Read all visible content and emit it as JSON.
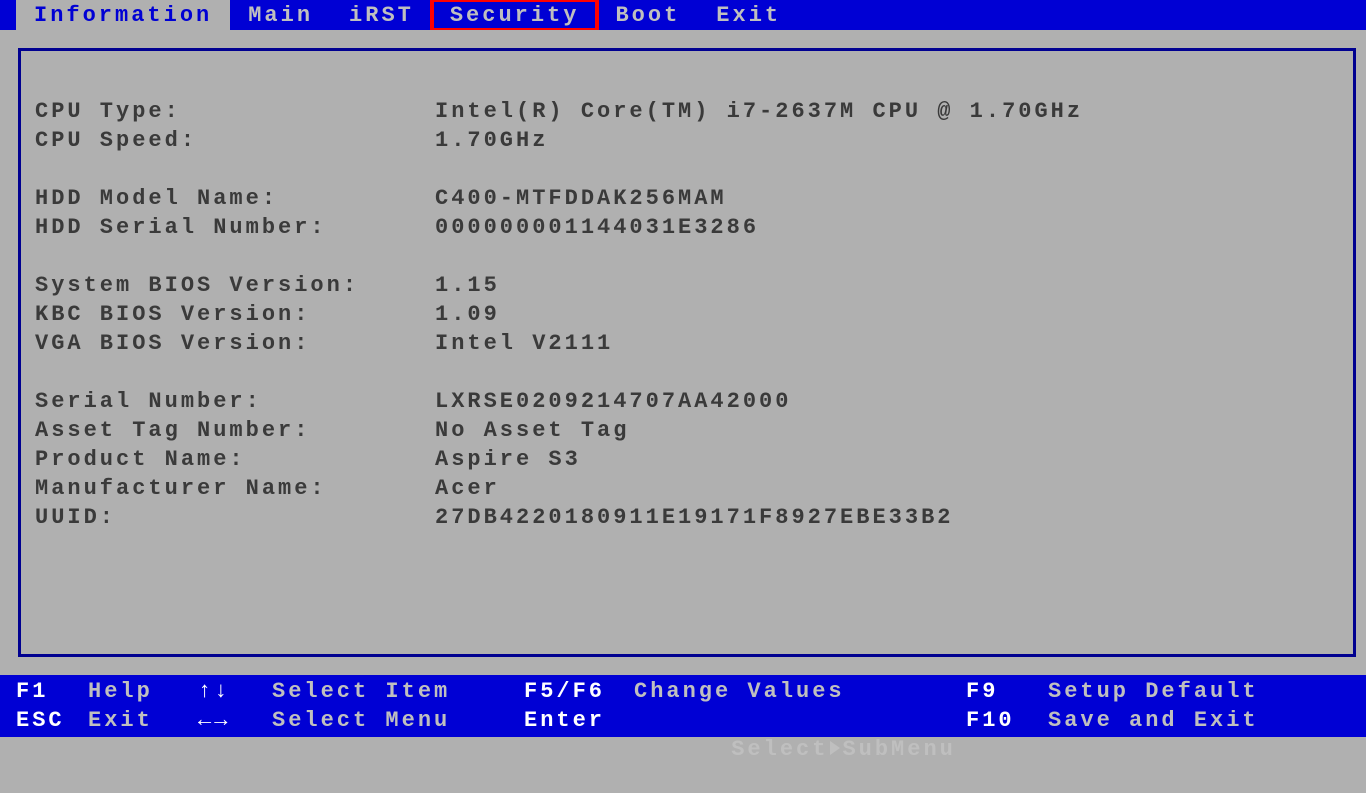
{
  "tabs": {
    "information": "Information",
    "main": "Main",
    "irst": "iRST",
    "security": "Security",
    "boot": "Boot",
    "exit": "Exit"
  },
  "info": {
    "cpu_type_label": "CPU Type:",
    "cpu_type_value": "Intel(R) Core(TM) i7-2637M CPU @ 1.70GHz",
    "cpu_speed_label": "CPU Speed:",
    "cpu_speed_value": "1.70GHz",
    "hdd_model_label": "HDD Model Name:",
    "hdd_model_value": "C400-MTFDDAK256MAM",
    "hdd_serial_label": "HDD Serial Number:",
    "hdd_serial_value": "000000001144031E3286",
    "sys_bios_label": "System BIOS Version:",
    "sys_bios_value": "1.15",
    "kbc_bios_label": "KBC BIOS Version:",
    "kbc_bios_value": "1.09",
    "vga_bios_label": "VGA BIOS Version:",
    "vga_bios_value": "Intel V2111",
    "serial_label": "Serial Number:",
    "serial_value": "LXRSE0209214707AA42000",
    "asset_label": "Asset Tag Number:",
    "asset_value": "No Asset Tag",
    "product_label": "Product Name:",
    "product_value": "Aspire S3",
    "manuf_label": "Manufacturer Name:",
    "manuf_value": "Acer",
    "uuid_label": "UUID:",
    "uuid_value": "27DB4220180911E19171F8927EBE33B2"
  },
  "help": {
    "r1": {
      "k1": "F1",
      "l1": "Help",
      "g1": "↑↓",
      "t1": "Select Item",
      "k2": "F5/F6",
      "t2": "Change Values",
      "k3": "F9",
      "t3": "Setup Default"
    },
    "r2": {
      "k1": "ESC",
      "l1": "Exit",
      "g1": "←→",
      "t1": "Select Menu",
      "k2": "Enter",
      "t2a": "Select",
      "t2b": "SubMenu",
      "k3": "F10",
      "t3": "Save and Exit"
    }
  }
}
